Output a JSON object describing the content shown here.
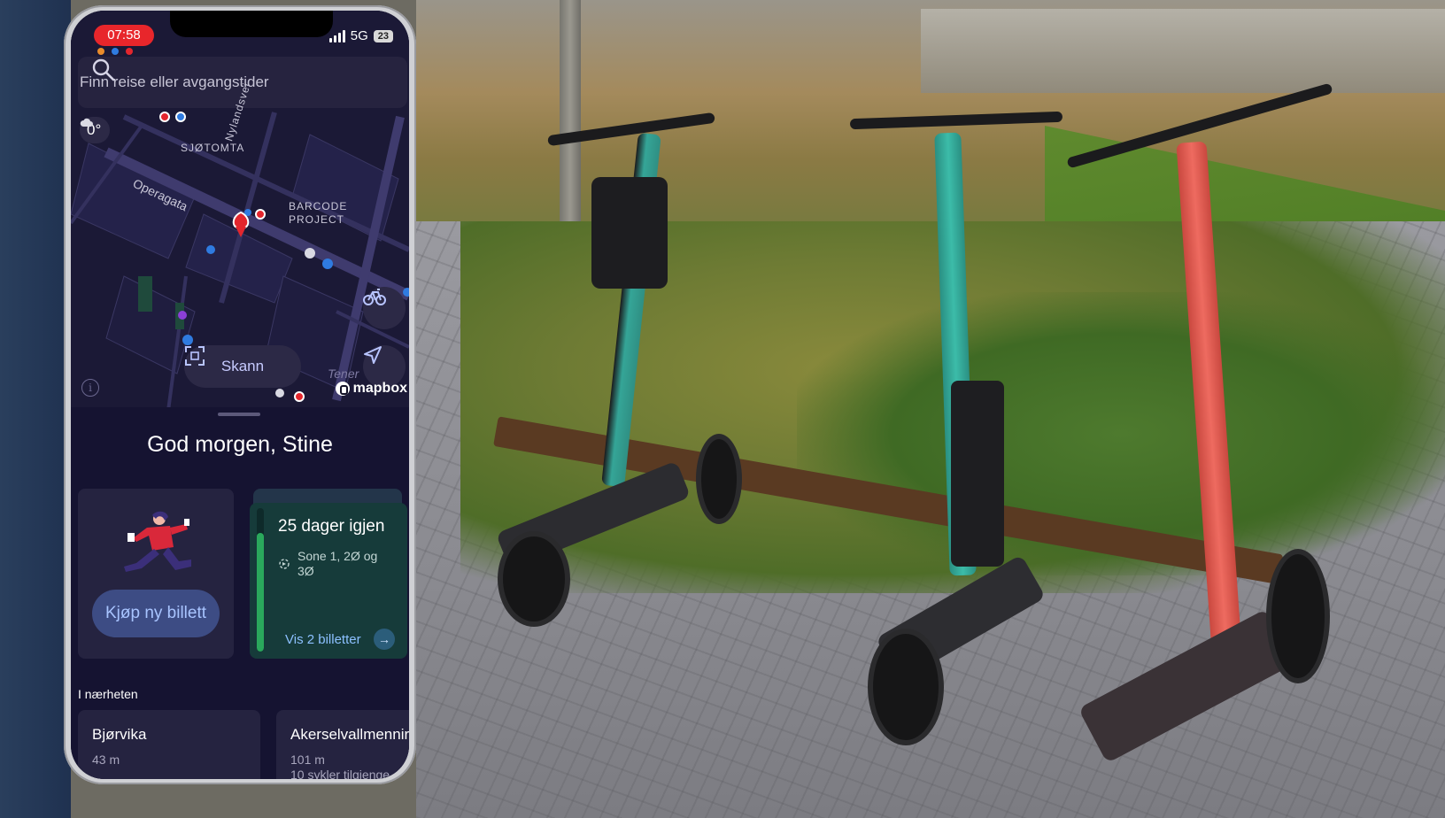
{
  "status_bar": {
    "time": "07:58",
    "network": "5G",
    "battery": "23"
  },
  "search": {
    "placeholder": "Finn reise eller avgangstider",
    "icon": "search-icon"
  },
  "weather": {
    "temperature": "0°",
    "icon": "cloud-icon"
  },
  "map": {
    "labels": {
      "sjotomta": "SJØTOMTA",
      "nylandsveien": "Nylandsvei",
      "operagata": "Operagata",
      "barcode_1": "BARCODE",
      "barcode_2": "PROJECT",
      "tener": "Tener"
    },
    "scan_label": "Skann",
    "attribution": "mapbox",
    "colors": {
      "background": "#1b1936",
      "road": "#3a3763",
      "block": "#24224a",
      "stop_blue": "#2f7be0",
      "stop_red": "#e3262d"
    }
  },
  "sheet": {
    "greeting": "God morgen, Stine",
    "buy_ticket": "Kjøp ny billett",
    "ticket": {
      "title": "25 dager igjen",
      "zone": "Sone 1, 2Ø og 3Ø",
      "link": "Vis 2 billetter",
      "progress": 0.83
    },
    "nearby": {
      "title": "I nærheten",
      "items": [
        {
          "name": "Bjørvika",
          "distance": "43 m",
          "bikes": ""
        },
        {
          "name": "Akerselvallmennir",
          "distance": "101 m",
          "bikes": "10 sykler tilgjenge"
        }
      ]
    }
  }
}
